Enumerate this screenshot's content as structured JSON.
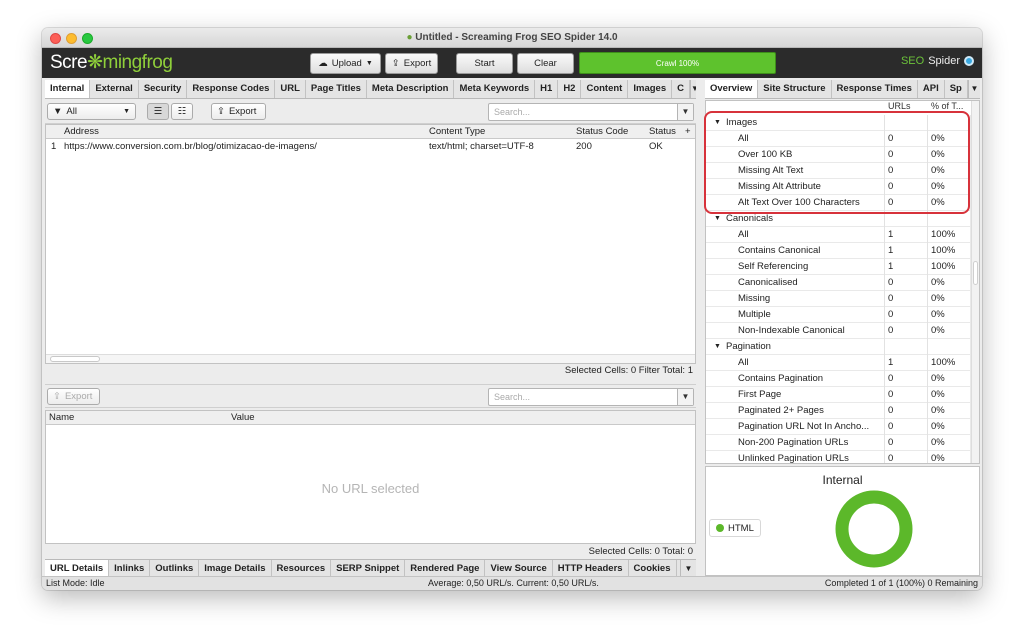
{
  "window": {
    "title": "Untitled - Screaming Frog SEO Spider 14.0"
  },
  "toolbar": {
    "logo_a": "Scre",
    "logo_b": "mingfrog",
    "upload": "Upload",
    "export": "Export",
    "start": "Start",
    "clear": "Clear",
    "progress": "Crawl 100%",
    "seo_a": "SEO",
    "seo_b": "Spider"
  },
  "main_tabs": [
    "Internal",
    "External",
    "Security",
    "Response Codes",
    "URL",
    "Page Titles",
    "Meta Description",
    "Meta Keywords",
    "H1",
    "H2",
    "Content",
    "Images",
    "C"
  ],
  "filter": {
    "value": "All",
    "export": "Export",
    "search_placeholder": "Search..."
  },
  "url_table": {
    "columns": [
      "Address",
      "Content Type",
      "Status Code",
      "Status"
    ],
    "rows": [
      [
        "1",
        "https://www.conversion.com.br/blog/otimizacao-de-imagens/",
        "text/html; charset=UTF-8",
        "200",
        "OK"
      ]
    ],
    "status_line": "Selected Cells: 0  Filter Total: 1"
  },
  "details": {
    "export": "Export",
    "search_placeholder": "Search...",
    "columns": [
      "Name",
      "Value"
    ],
    "empty": "No URL selected",
    "status_line": "Selected Cells: 0  Total: 0"
  },
  "bottom_tabs": [
    "URL Details",
    "Inlinks",
    "Outlinks",
    "Image Details",
    "Resources",
    "SERP Snippet",
    "Rendered Page",
    "View Source",
    "HTTP Headers",
    "Cookies"
  ],
  "right_tabs": [
    "Overview",
    "Site Structure",
    "Response Times",
    "API",
    "Sp"
  ],
  "overview": {
    "col1": "URLs",
    "col2": "% of T...",
    "rows": [
      {
        "kind": "sec",
        "label": "Images"
      },
      {
        "kind": "sub",
        "label": "All",
        "urls": "0",
        "pct": "0%"
      },
      {
        "kind": "sub",
        "label": "Over 100 KB",
        "urls": "0",
        "pct": "0%"
      },
      {
        "kind": "sub",
        "label": "Missing Alt Text",
        "urls": "0",
        "pct": "0%"
      },
      {
        "kind": "sub",
        "label": "Missing Alt Attribute",
        "urls": "0",
        "pct": "0%"
      },
      {
        "kind": "sub",
        "label": "Alt Text Over 100 Characters",
        "urls": "0",
        "pct": "0%"
      },
      {
        "kind": "sec",
        "label": "Canonicals"
      },
      {
        "kind": "sub",
        "label": "All",
        "urls": "1",
        "pct": "100%"
      },
      {
        "kind": "sub",
        "label": "Contains Canonical",
        "urls": "1",
        "pct": "100%"
      },
      {
        "kind": "sub",
        "label": "Self Referencing",
        "urls": "1",
        "pct": "100%"
      },
      {
        "kind": "sub",
        "label": "Canonicalised",
        "urls": "0",
        "pct": "0%"
      },
      {
        "kind": "sub",
        "label": "Missing",
        "urls": "0",
        "pct": "0%"
      },
      {
        "kind": "sub",
        "label": "Multiple",
        "urls": "0",
        "pct": "0%"
      },
      {
        "kind": "sub",
        "label": "Non-Indexable Canonical",
        "urls": "0",
        "pct": "0%"
      },
      {
        "kind": "sec",
        "label": "Pagination"
      },
      {
        "kind": "sub",
        "label": "All",
        "urls": "1",
        "pct": "100%"
      },
      {
        "kind": "sub",
        "label": "Contains Pagination",
        "urls": "0",
        "pct": "0%"
      },
      {
        "kind": "sub",
        "label": "First Page",
        "urls": "0",
        "pct": "0%"
      },
      {
        "kind": "sub",
        "label": "Paginated 2+ Pages",
        "urls": "0",
        "pct": "0%"
      },
      {
        "kind": "sub",
        "label": "Pagination URL Not In Ancho...",
        "urls": "0",
        "pct": "0%"
      },
      {
        "kind": "sub",
        "label": "Non-200 Pagination URLs",
        "urls": "0",
        "pct": "0%"
      },
      {
        "kind": "sub",
        "label": "Unlinked Pagination URLs",
        "urls": "0",
        "pct": "0%"
      }
    ]
  },
  "chart": {
    "title": "Internal",
    "legend": "HTML",
    "color": "#5cb82a",
    "fraction": 1
  },
  "statusbar": {
    "left": "List Mode: Idle",
    "center": "Average: 0,50 URL/s. Current: 0,50 URL/s.",
    "right": "Completed 1 of 1 (100%) 0 Remaining"
  }
}
